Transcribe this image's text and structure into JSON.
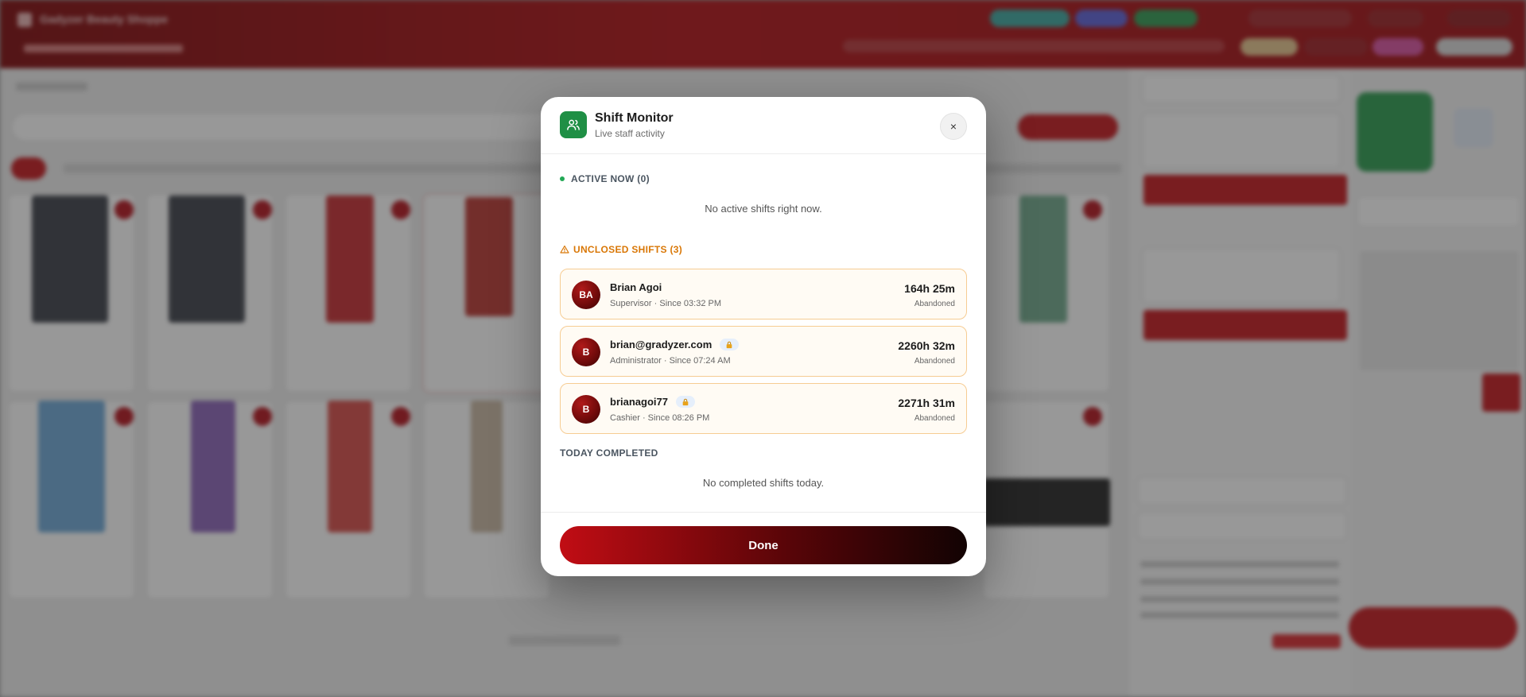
{
  "background_app": {
    "store_name": "Gadyzer Beauty Shoppe"
  },
  "modal": {
    "title": "Shift Monitor",
    "subtitle": "Live staff activity",
    "close_label": "×",
    "icon": "users-icon",
    "active": {
      "heading": "ACTIVE NOW (0)",
      "empty_text": "No active shifts right now."
    },
    "unclosed": {
      "heading": "UNCLOSED SHIFTS (3)",
      "icon": "warning-triangle-icon",
      "shifts": [
        {
          "initials": "BA",
          "name": "Brian Agoi",
          "meta": "Supervisor · Since 03:32 PM",
          "duration": "164h 25m",
          "status": "Abandoned",
          "locked": false
        },
        {
          "initials": "B",
          "name": "brian@gradyzer.com",
          "meta": "Administrator · Since 07:24 AM",
          "duration": "2260h 32m",
          "status": "Abandoned",
          "locked": true
        },
        {
          "initials": "B",
          "name": "brianagoi77",
          "meta": "Cashier · Since 08:26 PM",
          "duration": "2271h 31m",
          "status": "Abandoned",
          "locked": true
        }
      ]
    },
    "today": {
      "heading": "TODAY COMPLETED",
      "empty_text": "No completed shifts today."
    },
    "done_label": "Done"
  },
  "colors": {
    "brand_red": "#c10d14",
    "active_green": "#22a855",
    "warning_orange": "#d97706",
    "shift_border": "#f6cc93"
  }
}
